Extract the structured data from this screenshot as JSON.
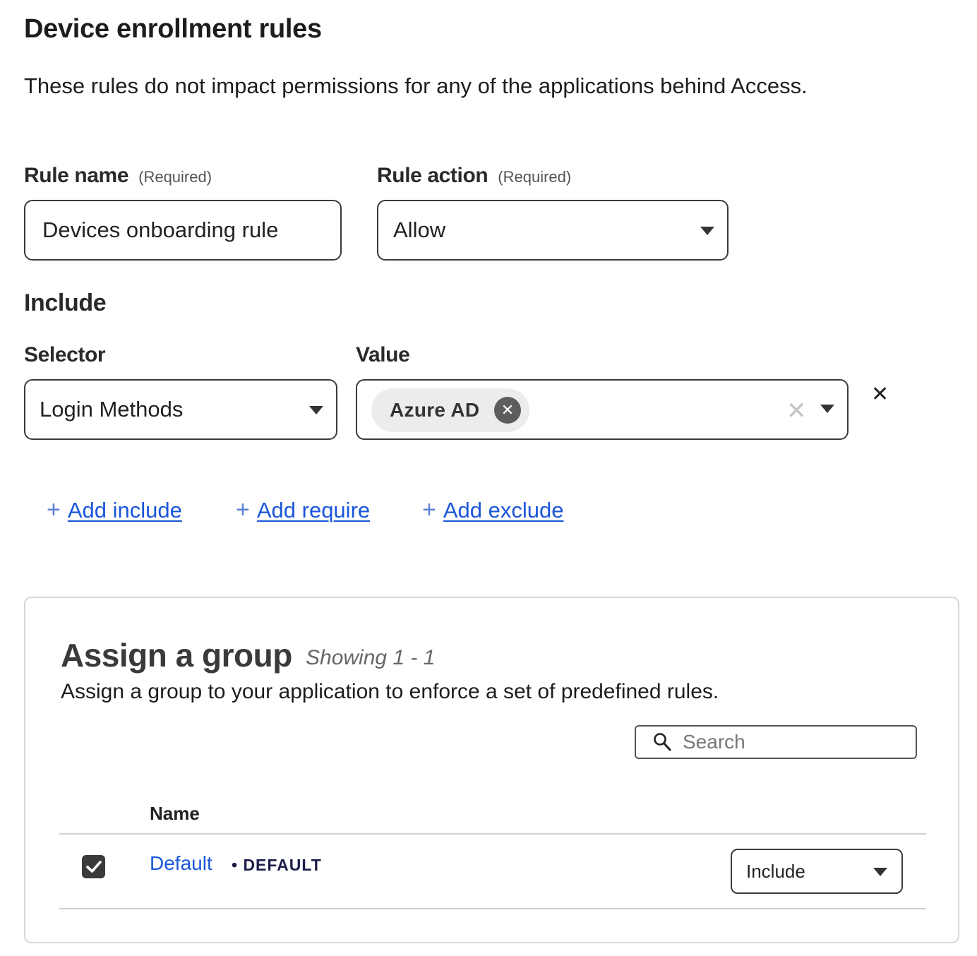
{
  "page": {
    "title": "Device enrollment rules",
    "description": "These rules do not impact permissions for any of the applications behind Access."
  },
  "rule_name": {
    "label": "Rule name",
    "required": "(Required)",
    "value": "Devices onboarding rule"
  },
  "rule_action": {
    "label": "Rule action",
    "required": "(Required)",
    "value": "Allow"
  },
  "include": {
    "heading": "Include",
    "selector_label": "Selector",
    "value_label": "Value",
    "selector_value": "Login Methods",
    "value_chips": [
      "Azure AD"
    ]
  },
  "add_links": {
    "include": "Add include",
    "require": "Add require",
    "exclude": "Add exclude"
  },
  "assign_group": {
    "title": "Assign a group",
    "showing": "Showing 1 - 1",
    "description": "Assign a group to your application to enforce a set of predefined rules.",
    "search_placeholder": "Search",
    "column_name": "Name",
    "rows": [
      {
        "checked": true,
        "name": "Default",
        "badge": "• DEFAULT",
        "mode": "Include"
      }
    ]
  },
  "colors": {
    "link": "#1a56db",
    "badge": "#1c1d4a",
    "border": "#3a3a3a"
  }
}
